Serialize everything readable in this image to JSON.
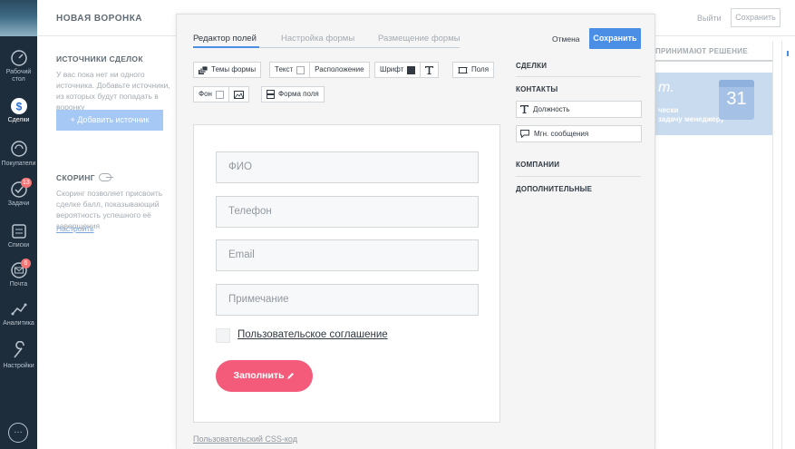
{
  "nav": {
    "items": [
      {
        "label": "Рабочий стол",
        "icon": "dashboard-icon"
      },
      {
        "label": "Сделки",
        "icon": "deals-icon"
      },
      {
        "label": "Покупатели",
        "icon": "customers-icon"
      },
      {
        "label": "Задачи",
        "icon": "tasks-icon",
        "badge": "13"
      },
      {
        "label": "Списки",
        "icon": "lists-icon"
      },
      {
        "label": "Почта",
        "icon": "mail-icon",
        "badge": "6"
      },
      {
        "label": "Аналитика",
        "icon": "analytics-icon"
      },
      {
        "label": "Настройки",
        "icon": "settings-icon"
      }
    ],
    "bottom_label": "…"
  },
  "background": {
    "title": "НОВАЯ ВОРОНКА",
    "exit": "Выйти",
    "save": "Сохранить",
    "sources_title": "ИСТОЧНИКИ СДЕЛОК",
    "sources_text": "У вас пока нет ни одного источника. Добавьте источники, из которых будут попадать в воронку",
    "add_source": "+ Добавить источник",
    "scoring_title": "СКОРИНГ",
    "scoring_text": "Скоринг позволяет присвоить сделке балл, показывающий вероятность успешного её завершения",
    "configure": "Настроить",
    "right_column_title": "ПРИНИМАЮТ РЕШЕНИЕ",
    "card_title": "m.",
    "card_text_1": "чески",
    "card_text_2": "задачу менеджеру",
    "calendar_day": "31"
  },
  "modal": {
    "tabs": [
      "Редактор полей",
      "Настройка формы",
      "Размещение формы"
    ],
    "cancel": "Отмена",
    "save": "Сохранить",
    "toolbar": {
      "themes": "Темы формы",
      "text": "Текст",
      "layout": "Расположение",
      "font": "Шрифт",
      "fields": "Поля",
      "background": "Фон",
      "field_shape": "Форма поля"
    },
    "form": {
      "fields": [
        "ФИО",
        "Телефон",
        "Email",
        "Примечание"
      ],
      "agreement": "Пользовательское соглашение",
      "submit": "Заполнить"
    },
    "css_link": "Пользовательский CSS-код",
    "sidebar": {
      "deals": "СДЕЛКИ",
      "contacts": "КОНТАКТЫ",
      "contact_items": [
        "Должность",
        "Мгн. сообщения"
      ],
      "companies": "КОМПАНИИ",
      "extra": "ДОПОЛНИТЕЛЬНЫЕ"
    }
  },
  "colors": {
    "accent": "#4a8ee6",
    "submit": "#f45b7a",
    "nav_bg": "#1d2d3c"
  }
}
